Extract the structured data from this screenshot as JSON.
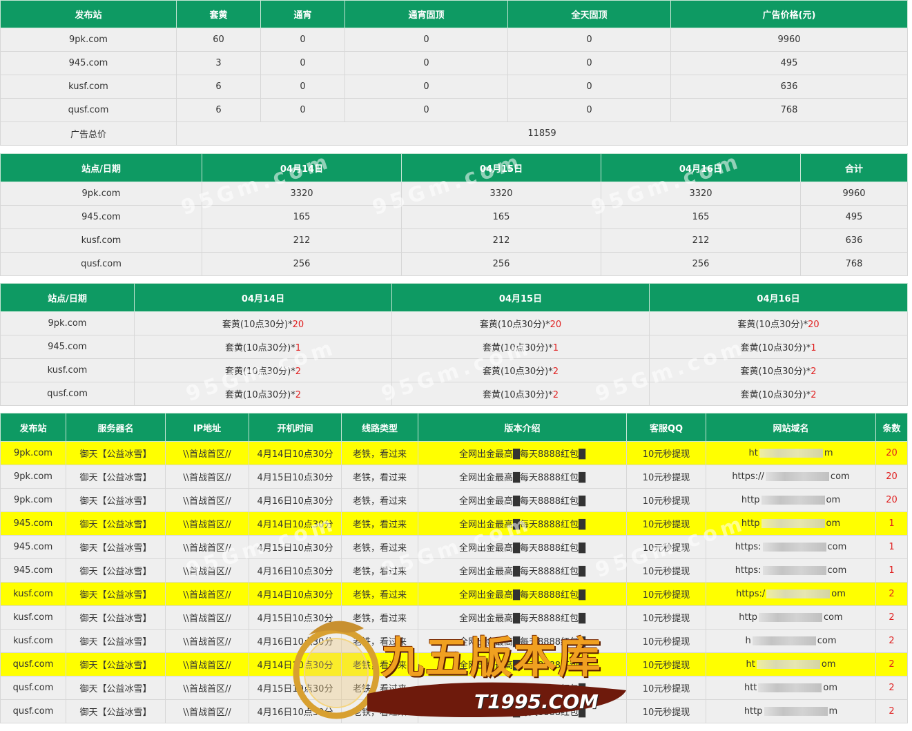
{
  "table1": {
    "headers": [
      "发布站",
      "套黄",
      "通宵",
      "通宵固顶",
      "全天固顶",
      "广告价格(元)"
    ],
    "rows": [
      [
        "9pk.com",
        "60",
        "0",
        "0",
        "0",
        "9960"
      ],
      [
        "945.com",
        "3",
        "0",
        "0",
        "0",
        "495"
      ],
      [
        "kusf.com",
        "6",
        "0",
        "0",
        "0",
        "636"
      ],
      [
        "qusf.com",
        "6",
        "0",
        "0",
        "0",
        "768"
      ]
    ],
    "total_label": "广告总价",
    "total_value": "11859"
  },
  "table2": {
    "headers": [
      "站点/日期",
      "04月14日",
      "04月15日",
      "04月16日",
      "合计"
    ],
    "rows": [
      [
        "9pk.com",
        "3320",
        "3320",
        "3320",
        "9960"
      ],
      [
        "945.com",
        "165",
        "165",
        "165",
        "495"
      ],
      [
        "kusf.com",
        "212",
        "212",
        "212",
        "636"
      ],
      [
        "qusf.com",
        "256",
        "256",
        "256",
        "768"
      ]
    ]
  },
  "table3": {
    "headers": [
      "站点/日期",
      "04月14日",
      "04月15日",
      "04月16日"
    ],
    "item_label": "套黄(10点30分)*",
    "rows": [
      {
        "site": "9pk.com",
        "counts": [
          "20",
          "20",
          "20"
        ]
      },
      {
        "site": "945.com",
        "counts": [
          "1",
          "1",
          "1"
        ]
      },
      {
        "site": "kusf.com",
        "counts": [
          "2",
          "2",
          "2"
        ]
      },
      {
        "site": "qusf.com",
        "counts": [
          "2",
          "2",
          "2"
        ]
      }
    ]
  },
  "table4": {
    "headers": [
      "发布站",
      "服务器名",
      "IP地址",
      "开机时间",
      "线路类型",
      "版本介绍",
      "客服QQ",
      "网站域名",
      "条数"
    ],
    "rows": [
      {
        "site": "9pk.com",
        "server": "御天【公益冰雪】",
        "ip": "\\\\首战首区//",
        "time": "4月14日10点30分",
        "line": "老铁，看过来",
        "version": "全网出金最高█每天8888红包█",
        "qq": "10元秒提现",
        "domain_start": "ht",
        "domain_end": "m",
        "count": "20",
        "highlight": true
      },
      {
        "site": "9pk.com",
        "server": "御天【公益冰雪】",
        "ip": "\\\\首战首区//",
        "time": "4月15日10点30分",
        "line": "老铁，看过来",
        "version": "全网出金最高█每天8888红包█",
        "qq": "10元秒提现",
        "domain_start": "https://",
        "domain_end": "com",
        "count": "20",
        "highlight": false
      },
      {
        "site": "9pk.com",
        "server": "御天【公益冰雪】",
        "ip": "\\\\首战首区//",
        "time": "4月16日10点30分",
        "line": "老铁，看过来",
        "version": "全网出金最高█每天8888红包█",
        "qq": "10元秒提现",
        "domain_start": "http",
        "domain_end": "om",
        "count": "20",
        "highlight": false
      },
      {
        "site": "945.com",
        "server": "御天【公益冰雪】",
        "ip": "\\\\首战首区//",
        "time": "4月14日10点30分",
        "line": "老铁，看过来",
        "version": "全网出金最高█每天8888红包█",
        "qq": "10元秒提现",
        "domain_start": "http",
        "domain_end": "om",
        "count": "1",
        "highlight": true
      },
      {
        "site": "945.com",
        "server": "御天【公益冰雪】",
        "ip": "\\\\首战首区//",
        "time": "4月15日10点30分",
        "line": "老铁，看过来",
        "version": "全网出金最高█每天8888红包█",
        "qq": "10元秒提现",
        "domain_start": "https:",
        "domain_end": "com",
        "count": "1",
        "highlight": false
      },
      {
        "site": "945.com",
        "server": "御天【公益冰雪】",
        "ip": "\\\\首战首区//",
        "time": "4月16日10点30分",
        "line": "老铁，看过来",
        "version": "全网出金最高█每天8888红包█",
        "qq": "10元秒提现",
        "domain_start": "https:",
        "domain_end": "com",
        "count": "1",
        "highlight": false
      },
      {
        "site": "kusf.com",
        "server": "御天【公益冰雪】",
        "ip": "\\\\首战首区//",
        "time": "4月14日10点30分",
        "line": "老铁，看过来",
        "version": "全网出金最高█每天8888红包█",
        "qq": "10元秒提现",
        "domain_start": "https:/",
        "domain_end": "om",
        "count": "2",
        "highlight": true
      },
      {
        "site": "kusf.com",
        "server": "御天【公益冰雪】",
        "ip": "\\\\首战首区//",
        "time": "4月15日10点30分",
        "line": "老铁，看过来",
        "version": "全网出金最高█每天8888红包█",
        "qq": "10元秒提现",
        "domain_start": "http",
        "domain_end": "com",
        "count": "2",
        "highlight": false
      },
      {
        "site": "kusf.com",
        "server": "御天【公益冰雪】",
        "ip": "\\\\首战首区//",
        "time": "4月16日10点30分",
        "line": "老铁，看过来",
        "version": "全网出金最高█每天8888红包█",
        "qq": "10元秒提现",
        "domain_start": "h",
        "domain_end": "com",
        "count": "2",
        "highlight": false
      },
      {
        "site": "qusf.com",
        "server": "御天【公益冰雪】",
        "ip": "\\\\首战首区//",
        "time": "4月14日10点30分",
        "line": "老铁，看过来",
        "version": "全网出金最高█每天8888红包█",
        "qq": "10元秒提现",
        "domain_start": "ht",
        "domain_end": "om",
        "count": "2",
        "highlight": true
      },
      {
        "site": "qusf.com",
        "server": "御天【公益冰雪】",
        "ip": "\\\\首战首区//",
        "time": "4月15日10点30分",
        "line": "老铁，看过来",
        "version": "全网出金最高█每天8888红包█",
        "qq": "10元秒提现",
        "domain_start": "htt",
        "domain_end": "om",
        "count": "2",
        "highlight": false
      },
      {
        "site": "qusf.com",
        "server": "御天【公益冰雪】",
        "ip": "\\\\首战首区//",
        "time": "4月16日10点30分",
        "line": "老铁，看过来",
        "version": "全网出金最高█每天8888红包█",
        "qq": "10元秒提现",
        "domain_start": "http",
        "domain_end": "m",
        "count": "2",
        "highlight": false
      }
    ]
  },
  "watermark": {
    "text": "95Gm.com"
  },
  "logo": {
    "title": "九五版本库",
    "url": "T1995.COM"
  },
  "colors": {
    "header_green": "#0e9a63",
    "highlight_yellow": "#ffff00",
    "count_red": "#e02020",
    "cell_gray": "#efefef"
  }
}
